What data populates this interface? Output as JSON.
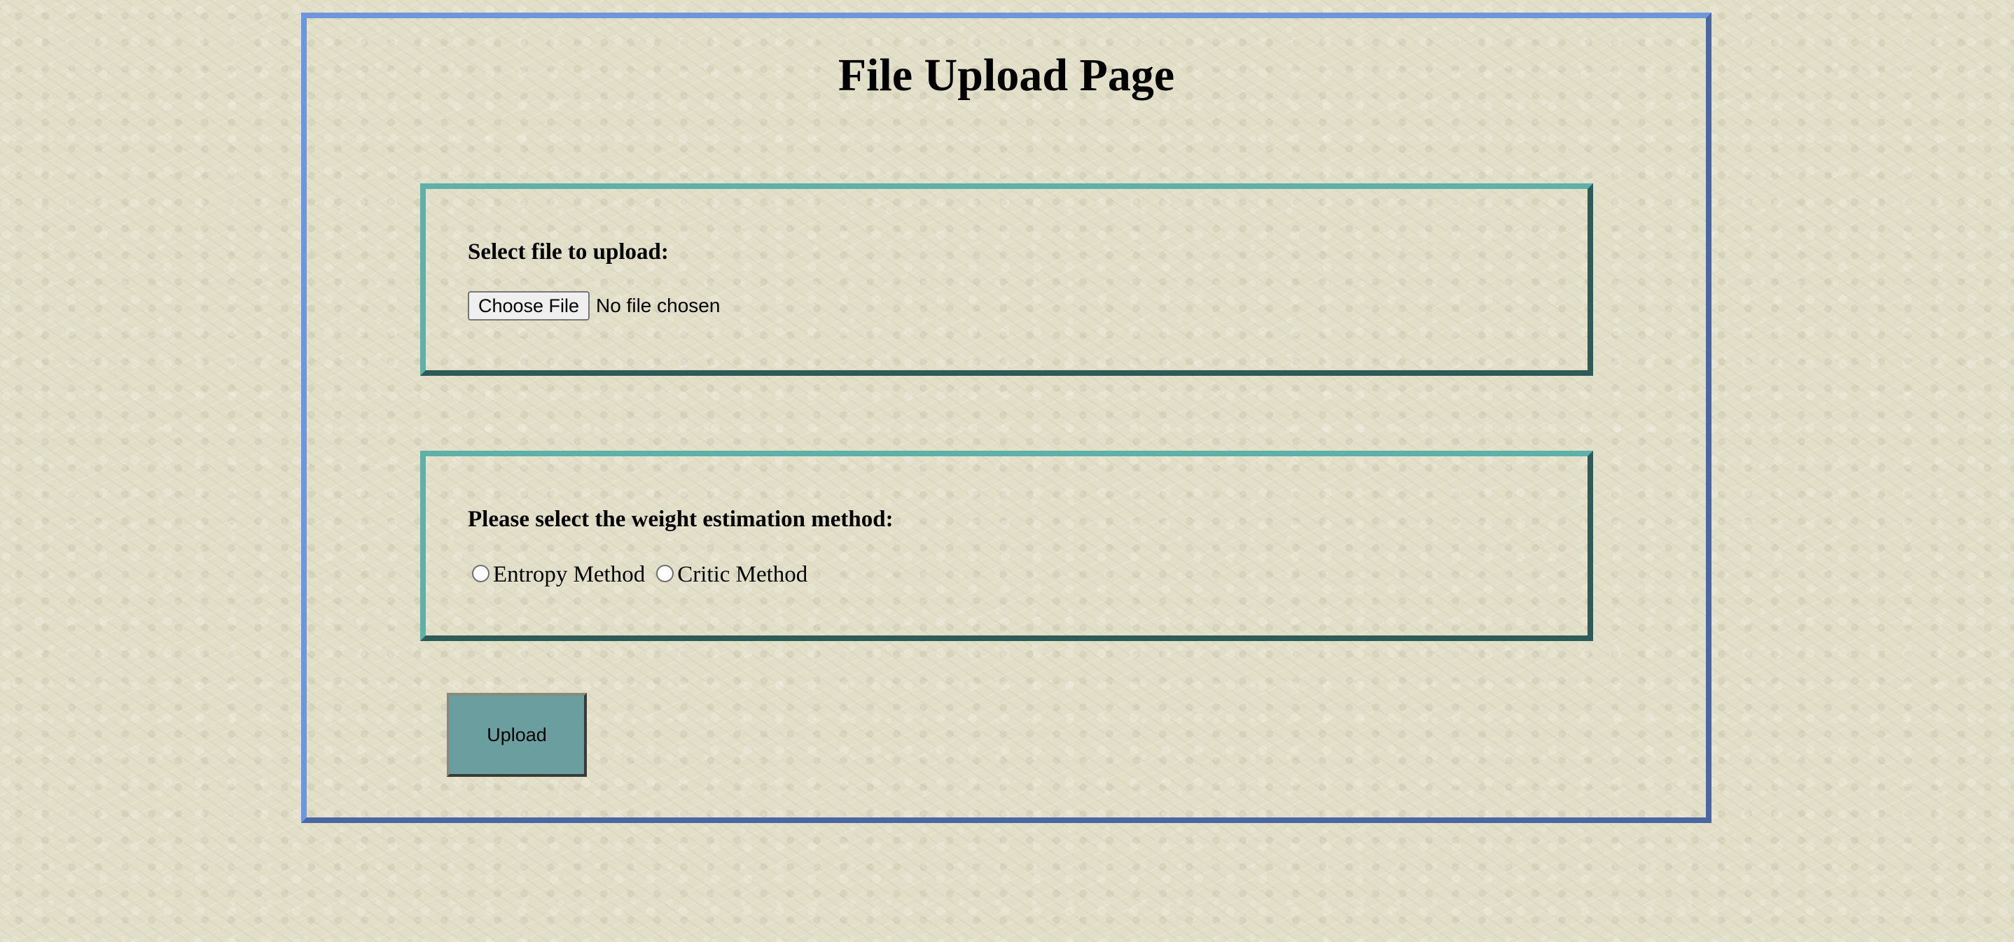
{
  "page": {
    "title": "File Upload Page"
  },
  "file_panel": {
    "heading": "Select file to upload:",
    "choose_button_label": "Choose File",
    "file_status": "No file chosen"
  },
  "method_panel": {
    "heading": "Please select the weight estimation method:",
    "options": [
      {
        "label": "Entropy Method",
        "selected": false
      },
      {
        "label": "Critic Method",
        "selected": false
      }
    ]
  },
  "upload_button": {
    "label": "Upload"
  },
  "colors": {
    "page_background": "#e2dfc8",
    "outer_border": "#6f96dc",
    "panel_border": "#5fb0a8",
    "upload_button": "#6b9f9f"
  }
}
